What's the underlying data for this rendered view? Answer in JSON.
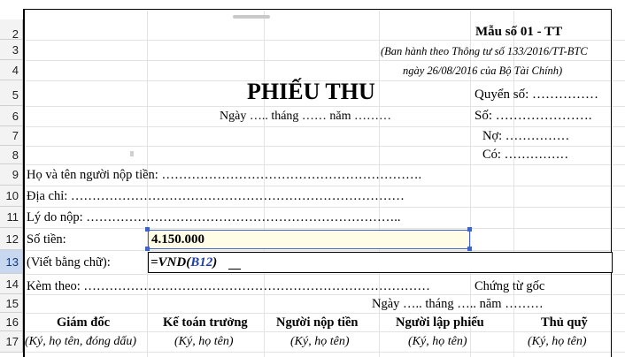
{
  "rows": [
    "2",
    "3",
    "4",
    "5",
    "6",
    "7",
    "8",
    "9",
    "10",
    "11",
    "12",
    "13",
    "14",
    "15",
    "16",
    "17"
  ],
  "active_row": "13",
  "form": {
    "template_no": "Mẫu số 01 - TT",
    "issued_line1": "(Ban hành theo Thông tư số 133/2016/TT-BTC",
    "issued_line2": "ngày 26/08/2016 của Bộ Tài Chính)",
    "title": "PHIẾU THU",
    "date_line": "Ngày ….. tháng …… năm ………",
    "book_no": "Quyển số: ……………",
    "doc_no": "Số: ………………….",
    "debit": "Nợ:    ……………",
    "credit": "Có:    ……………",
    "payer": "Họ và tên người nộp tiền: …………………………………………………….",
    "address": "Địa chỉ: ……………………………………………………………………",
    "reason": "Lý do nộp: ………………………………………………………………..",
    "amount_label": "Số tiền:",
    "amount_value": "4.150.000",
    "words_label": "(Viết bằng chữ):",
    "formula_prefix": "=VND(",
    "formula_ref": "B12",
    "formula_suffix": ")",
    "attached": "Kèm theo: ………………………………………………………………………",
    "original_docs": "Chứng từ gốc",
    "sign_date": "Ngày ….. tháng ….. năm ………",
    "signers": [
      {
        "title": "Giám đốc",
        "note": "(Ký, họ tên, đóng dấu)"
      },
      {
        "title": "Kế toán trưởng",
        "note": "(Ký, họ tên)"
      },
      {
        "title": "Người nộp tiền",
        "note": "(Ký, họ tên)"
      },
      {
        "title": "Người lập phiếu",
        "note": "(Ký, họ tên)"
      },
      {
        "title": "Thủ quỹ",
        "note": "(Ký, họ tên)"
      }
    ]
  },
  "colors": {
    "selection": "#3f63c9",
    "formula_ref": "#1f3fa8",
    "active_header": "#c7d7f0"
  }
}
